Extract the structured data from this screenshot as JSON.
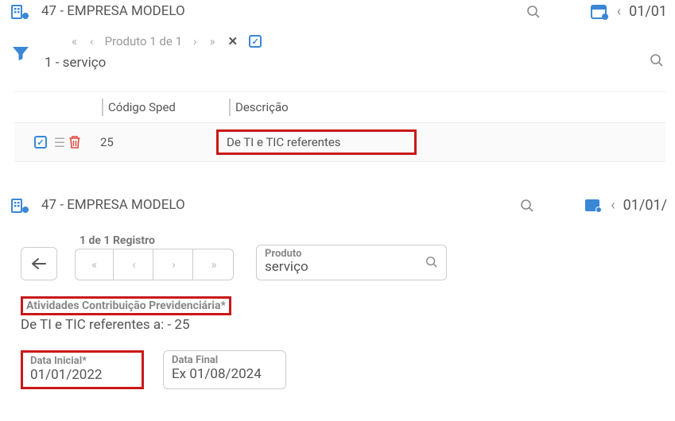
{
  "colors": {
    "highlight_border": "#c91818",
    "accent": "#3a87d6",
    "danger": "#e04a3f"
  },
  "top": {
    "company_value": "47 - EMPRESA MODELO",
    "date_fragment": "01/01",
    "pager_label": "Produto 1 de 1",
    "product_value": "1 - serviço"
  },
  "table": {
    "headers": {
      "code": "Código Sped",
      "desc": "Descrição"
    },
    "row": {
      "code": "25",
      "desc": "De TI e TIC referentes"
    }
  },
  "bottom": {
    "company_value": "47 - EMPRESA MODELO",
    "date_fragment": "01/01/",
    "register_label": "1 de 1 Registro",
    "product_label": "Produto",
    "product_value": "serviço",
    "activity_label": "Atividades Contribuição Previdenciária*",
    "activity_value": "De TI e TIC referentes a: - 25",
    "date_initial_label": "Data Inicial*",
    "date_initial_value": "01/01/2022",
    "date_final_label": "Data Final",
    "date_final_placeholder": "Ex 01/08/2024"
  }
}
